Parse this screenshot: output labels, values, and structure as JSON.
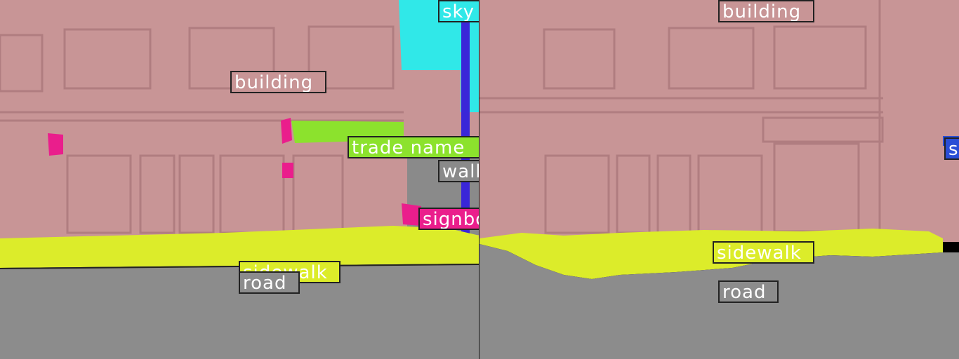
{
  "panels": [
    {
      "name": "left",
      "labels": {
        "sky": "sky",
        "building": "building",
        "trade_name": "trade name",
        "wall": "wall",
        "signboard": "signboard",
        "sidewalk": "sidewalk",
        "road": "road"
      }
    },
    {
      "name": "right",
      "labels": {
        "building": "building",
        "signboard_partial": "signboard",
        "sidewalk": "sidewalk",
        "road": "road"
      }
    }
  ],
  "colors": {
    "building": "#c89596",
    "sky": "#30e8e8",
    "trade_name": "#8ce22d",
    "wall": "#8a8a8a",
    "signboard": "#ea1e8c",
    "sidewalk": "#dcec2a",
    "road": "#8c8c8c",
    "pole": "#3a26d8",
    "label_border": "#222222",
    "signboard_blue": "#2a4ed6"
  }
}
